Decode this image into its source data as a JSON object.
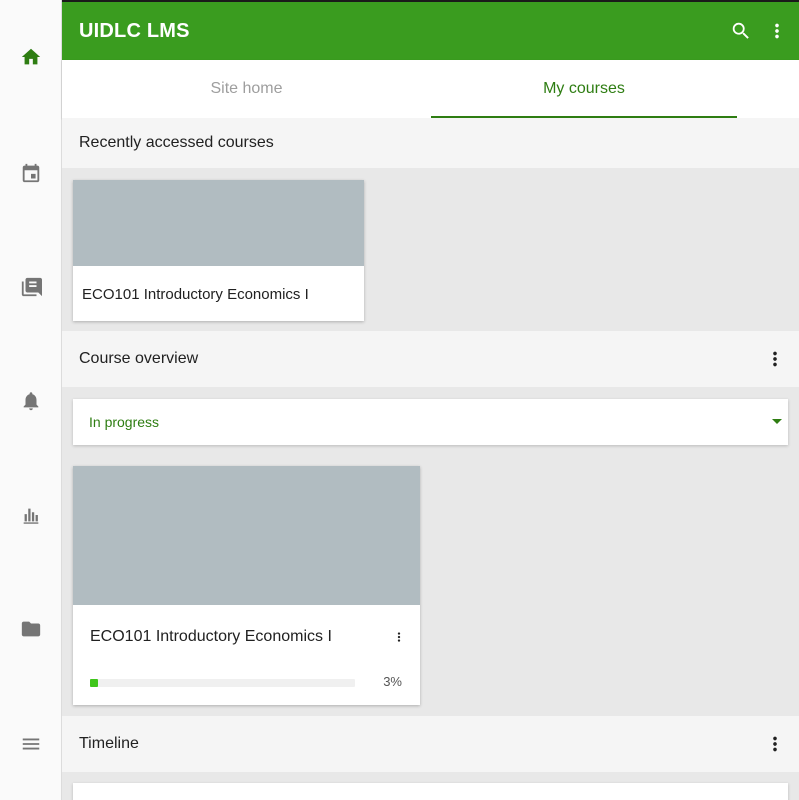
{
  "app": {
    "title": "UIDLC LMS"
  },
  "rail": {
    "items": [
      {
        "icon": "home-icon",
        "active": true
      },
      {
        "icon": "calendar-icon"
      },
      {
        "icon": "messages-icon"
      },
      {
        "icon": "notifications-icon"
      },
      {
        "icon": "grades-icon"
      },
      {
        "icon": "files-icon"
      },
      {
        "icon": "menu-icon"
      }
    ]
  },
  "tabs": [
    {
      "label": "Site home",
      "active": false
    },
    {
      "label": "My courses",
      "active": true
    }
  ],
  "recent": {
    "title": "Recently accessed courses",
    "course_name": "ECO101 Introductory Economics I"
  },
  "overview": {
    "title": "Course overview",
    "filter_value": "In progress",
    "course_name": "ECO101 Introductory Economics I",
    "progress_label": "3%",
    "progress_fraction": 0.03
  },
  "timeline": {
    "title": "Timeline"
  },
  "colors": {
    "primary": "#3a9c1f",
    "accent_text": "#2e7d12",
    "progress": "#3ec51a",
    "card_image": "#b1bcc1"
  }
}
